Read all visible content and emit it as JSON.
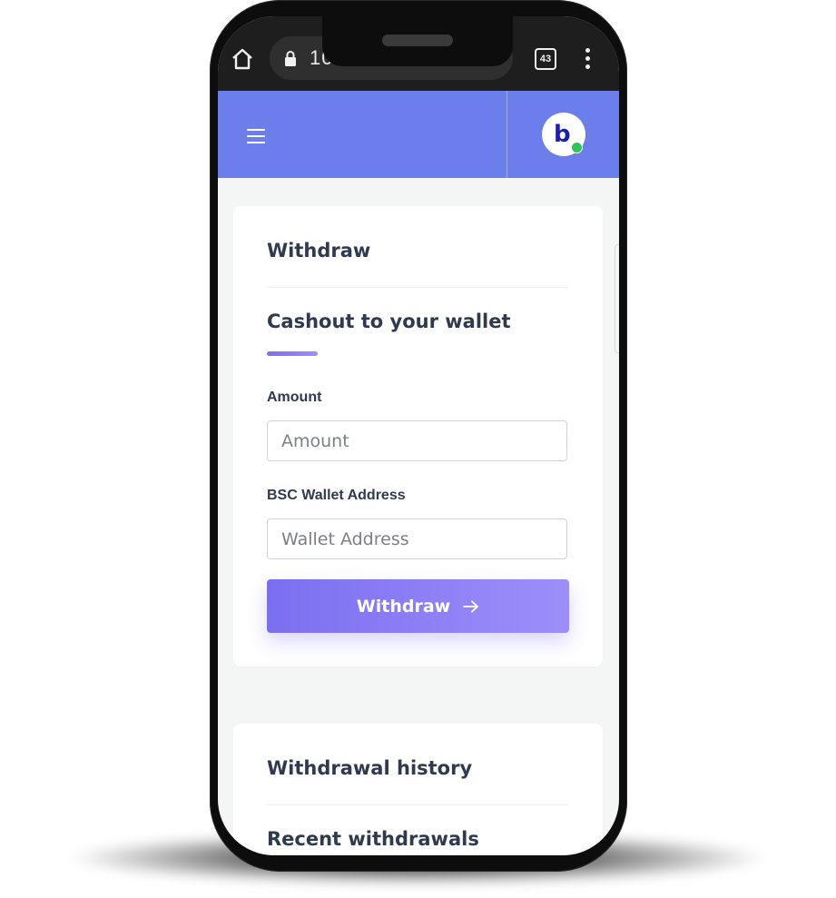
{
  "browser": {
    "url_visible_fragment": "10",
    "tab_count": "43"
  },
  "withdraw_card": {
    "title": "Withdraw",
    "section_title": "Cashout to your wallet",
    "amount_label": "Amount",
    "amount_placeholder": "Amount",
    "wallet_label": "BSC Wallet Address",
    "wallet_placeholder": "Wallet Address",
    "button_label": "Withdraw"
  },
  "history_card": {
    "title": "Withdrawal history",
    "section_title": "Recent withdrawals"
  },
  "avatar": {
    "logo_letter": "b"
  },
  "colors": {
    "header": "#6b7ee9",
    "accent": "#7b6ff0",
    "accent_light": "#9d8ff9",
    "online": "#2ec25a",
    "text": "#2f3a4f"
  },
  "icons": [
    "home-icon",
    "lock-icon",
    "tabs-icon",
    "more-vert-icon",
    "hamburger-menu-icon",
    "arrow-right-icon"
  ]
}
